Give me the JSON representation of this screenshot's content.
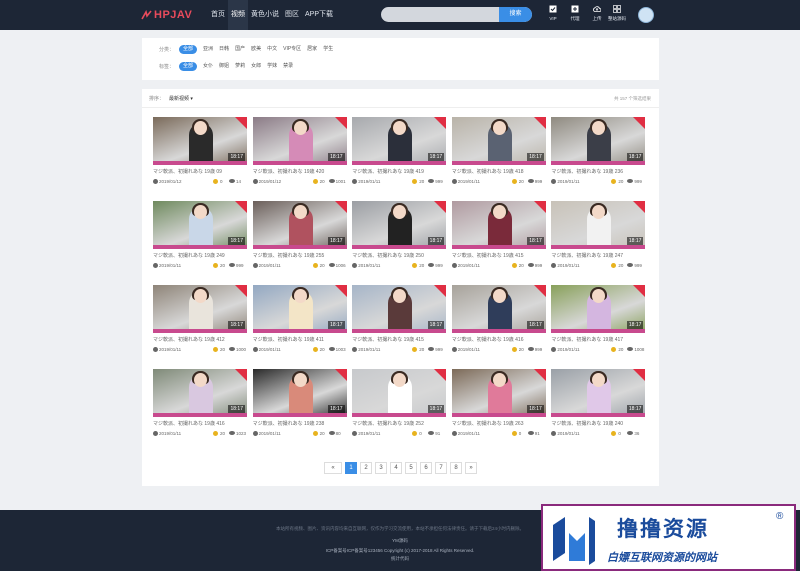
{
  "header": {
    "logo_text": "HPJAV",
    "nav": [
      "首页",
      "视频",
      "黄色小说",
      "图区",
      "APP下载"
    ],
    "nav_active": 1,
    "search": {
      "placeholder": "",
      "button": "搜索"
    },
    "tools": [
      {
        "label": "VIP",
        "icon": "vip-check-icon"
      },
      {
        "label": "代理",
        "icon": "agent-icon"
      },
      {
        "label": "上传",
        "icon": "cloud-upload-icon"
      },
      {
        "label": "整站源码",
        "icon": "grid-icon"
      }
    ]
  },
  "filters": {
    "category": {
      "label": "分类：",
      "items": [
        "全部",
        "亚洲",
        "日韩",
        "国产",
        "欧美",
        "中文",
        "VIP专区",
        "居家",
        "学生"
      ]
    },
    "tags": {
      "label": "标签：",
      "items": [
        "全部",
        "女仆",
        "御姐",
        "萝莉",
        "女郎",
        "学妹",
        "禁录"
      ]
    }
  },
  "listing": {
    "sort_label": "排序：",
    "sort_value": "最新视频 ▾",
    "count": "共 157 个筛选结果"
  },
  "videos": [
    {
      "title": "マジ軟派、初撮れあな 19歳 09",
      "date": "2019/01/12",
      "coins": "0",
      "views": "14",
      "duration": "18:17"
    },
    {
      "title": "マジ軟派、初撮れあな 19歳 420",
      "date": "2019/01/12",
      "coins": "20",
      "views": "1001",
      "duration": "18:17"
    },
    {
      "title": "マジ軟派、初撮れあな 19歳 419",
      "date": "2019/01/11",
      "coins": "20",
      "views": "999",
      "duration": "18:17"
    },
    {
      "title": "マジ軟派、初撮れあな 19歳 418",
      "date": "2019/01/11",
      "coins": "20",
      "views": "999",
      "duration": "18:17"
    },
    {
      "title": "マジ軟派、初撮れあな 19歳 236",
      "date": "2019/01/11",
      "coins": "20",
      "views": "999",
      "duration": "18:17"
    },
    {
      "title": "マジ軟派、初撮れあな 19歳 249",
      "date": "2019/01/11",
      "coins": "20",
      "views": "999",
      "duration": "18:17"
    },
    {
      "title": "マジ軟派、初撮れあな 19歳 255",
      "date": "2019/01/11",
      "coins": "20",
      "views": "1006",
      "duration": "18:17"
    },
    {
      "title": "マジ軟派、初撮れあな 19歳 250",
      "date": "2019/01/11",
      "coins": "20",
      "views": "999",
      "duration": "18:17"
    },
    {
      "title": "マジ軟派、初撮れあな 19歳 415",
      "date": "2019/01/11",
      "coins": "20",
      "views": "999",
      "duration": "18:17"
    },
    {
      "title": "マジ軟派、初撮れあな 19歳 247",
      "date": "2019/01/11",
      "coins": "20",
      "views": "999",
      "duration": "18:17"
    },
    {
      "title": "マジ軟派、初撮れあな 19歳 412",
      "date": "2019/01/11",
      "coins": "20",
      "views": "1000",
      "duration": "18:17"
    },
    {
      "title": "マジ軟派、初撮れあな 19歳 411",
      "date": "2019/01/11",
      "coins": "20",
      "views": "1003",
      "duration": "18:17"
    },
    {
      "title": "マジ軟派、初撮れあな 19歳 415",
      "date": "2019/01/11",
      "coins": "20",
      "views": "999",
      "duration": "18:17"
    },
    {
      "title": "マジ軟派、初撮れあな 19歳 416",
      "date": "2019/01/11",
      "coins": "20",
      "views": "999",
      "duration": "18:17"
    },
    {
      "title": "マジ軟派、初撮れあな 19歳 417",
      "date": "2019/01/11",
      "coins": "20",
      "views": "1008",
      "duration": "18:17"
    },
    {
      "title": "マジ軟派、初撮れあな 19歳 416",
      "date": "2019/01/11",
      "coins": "20",
      "views": "1023",
      "duration": "18:17"
    },
    {
      "title": "マジ軟派、初撮れあな 19歳 238",
      "date": "2019/01/11",
      "coins": "20",
      "views": "80",
      "duration": "18:17"
    },
    {
      "title": "マジ軟派、初撮れあな 19歳 252",
      "date": "2019/01/11",
      "coins": "0",
      "views": "91",
      "duration": "18:17"
    },
    {
      "title": "マジ軟派、初撮れあな 19歳 263",
      "date": "2019/01/11",
      "coins": "0",
      "views": "91",
      "duration": "18:17"
    },
    {
      "title": "マジ軟派、初撮れあな 19歳 240",
      "date": "2019/01/11",
      "coins": "0",
      "views": "36",
      "duration": "18:17"
    }
  ],
  "pagination": {
    "prev": "«",
    "pages": [
      "1",
      "2",
      "3",
      "4",
      "5",
      "6",
      "7",
      "8"
    ],
    "current": "1",
    "next": "»"
  },
  "footer": {
    "disclaimer": "本站所有视频、图片、资讯内容均来自互联网，仅作为学习交流使用，本站不承担任何法律责任。请于下载后24小时内删除。",
    "site": "YM源码",
    "icp": "ICP备案号ICP备案号123456   Copyright (c) 2017-2018 All Rights Reserved.",
    "stats": "统计代码"
  },
  "watermark": {
    "title": "撸撸资源",
    "subtitle": "白嫖互联网资源的网站",
    "reg": "®"
  },
  "colors": {
    "header_bg": "#1d2636",
    "accent": "#3a8ee6",
    "logo_red": "#e94b5c",
    "coin": "#e8b31e",
    "badge_blue": "#1a4b9c"
  }
}
